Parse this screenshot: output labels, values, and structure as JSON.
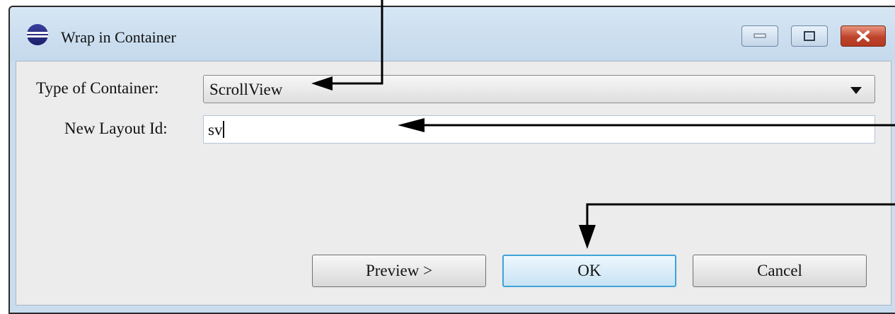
{
  "window": {
    "title": "Wrap in Container",
    "controls": {
      "minimize_icon": "minimize-icon",
      "maximize_icon": "maximize-icon",
      "close_icon": "close-icon"
    }
  },
  "form": {
    "type_label": "Type of Container:",
    "type_value": "ScrollView",
    "id_label": "New Layout Id:",
    "id_value": "sv"
  },
  "buttons": {
    "preview": "Preview >",
    "ok": "OK",
    "cancel": "Cancel"
  },
  "colors": {
    "frame": "#c9ddee",
    "close_button": "#c0432b",
    "default_button_border": "#3fa3d8"
  }
}
